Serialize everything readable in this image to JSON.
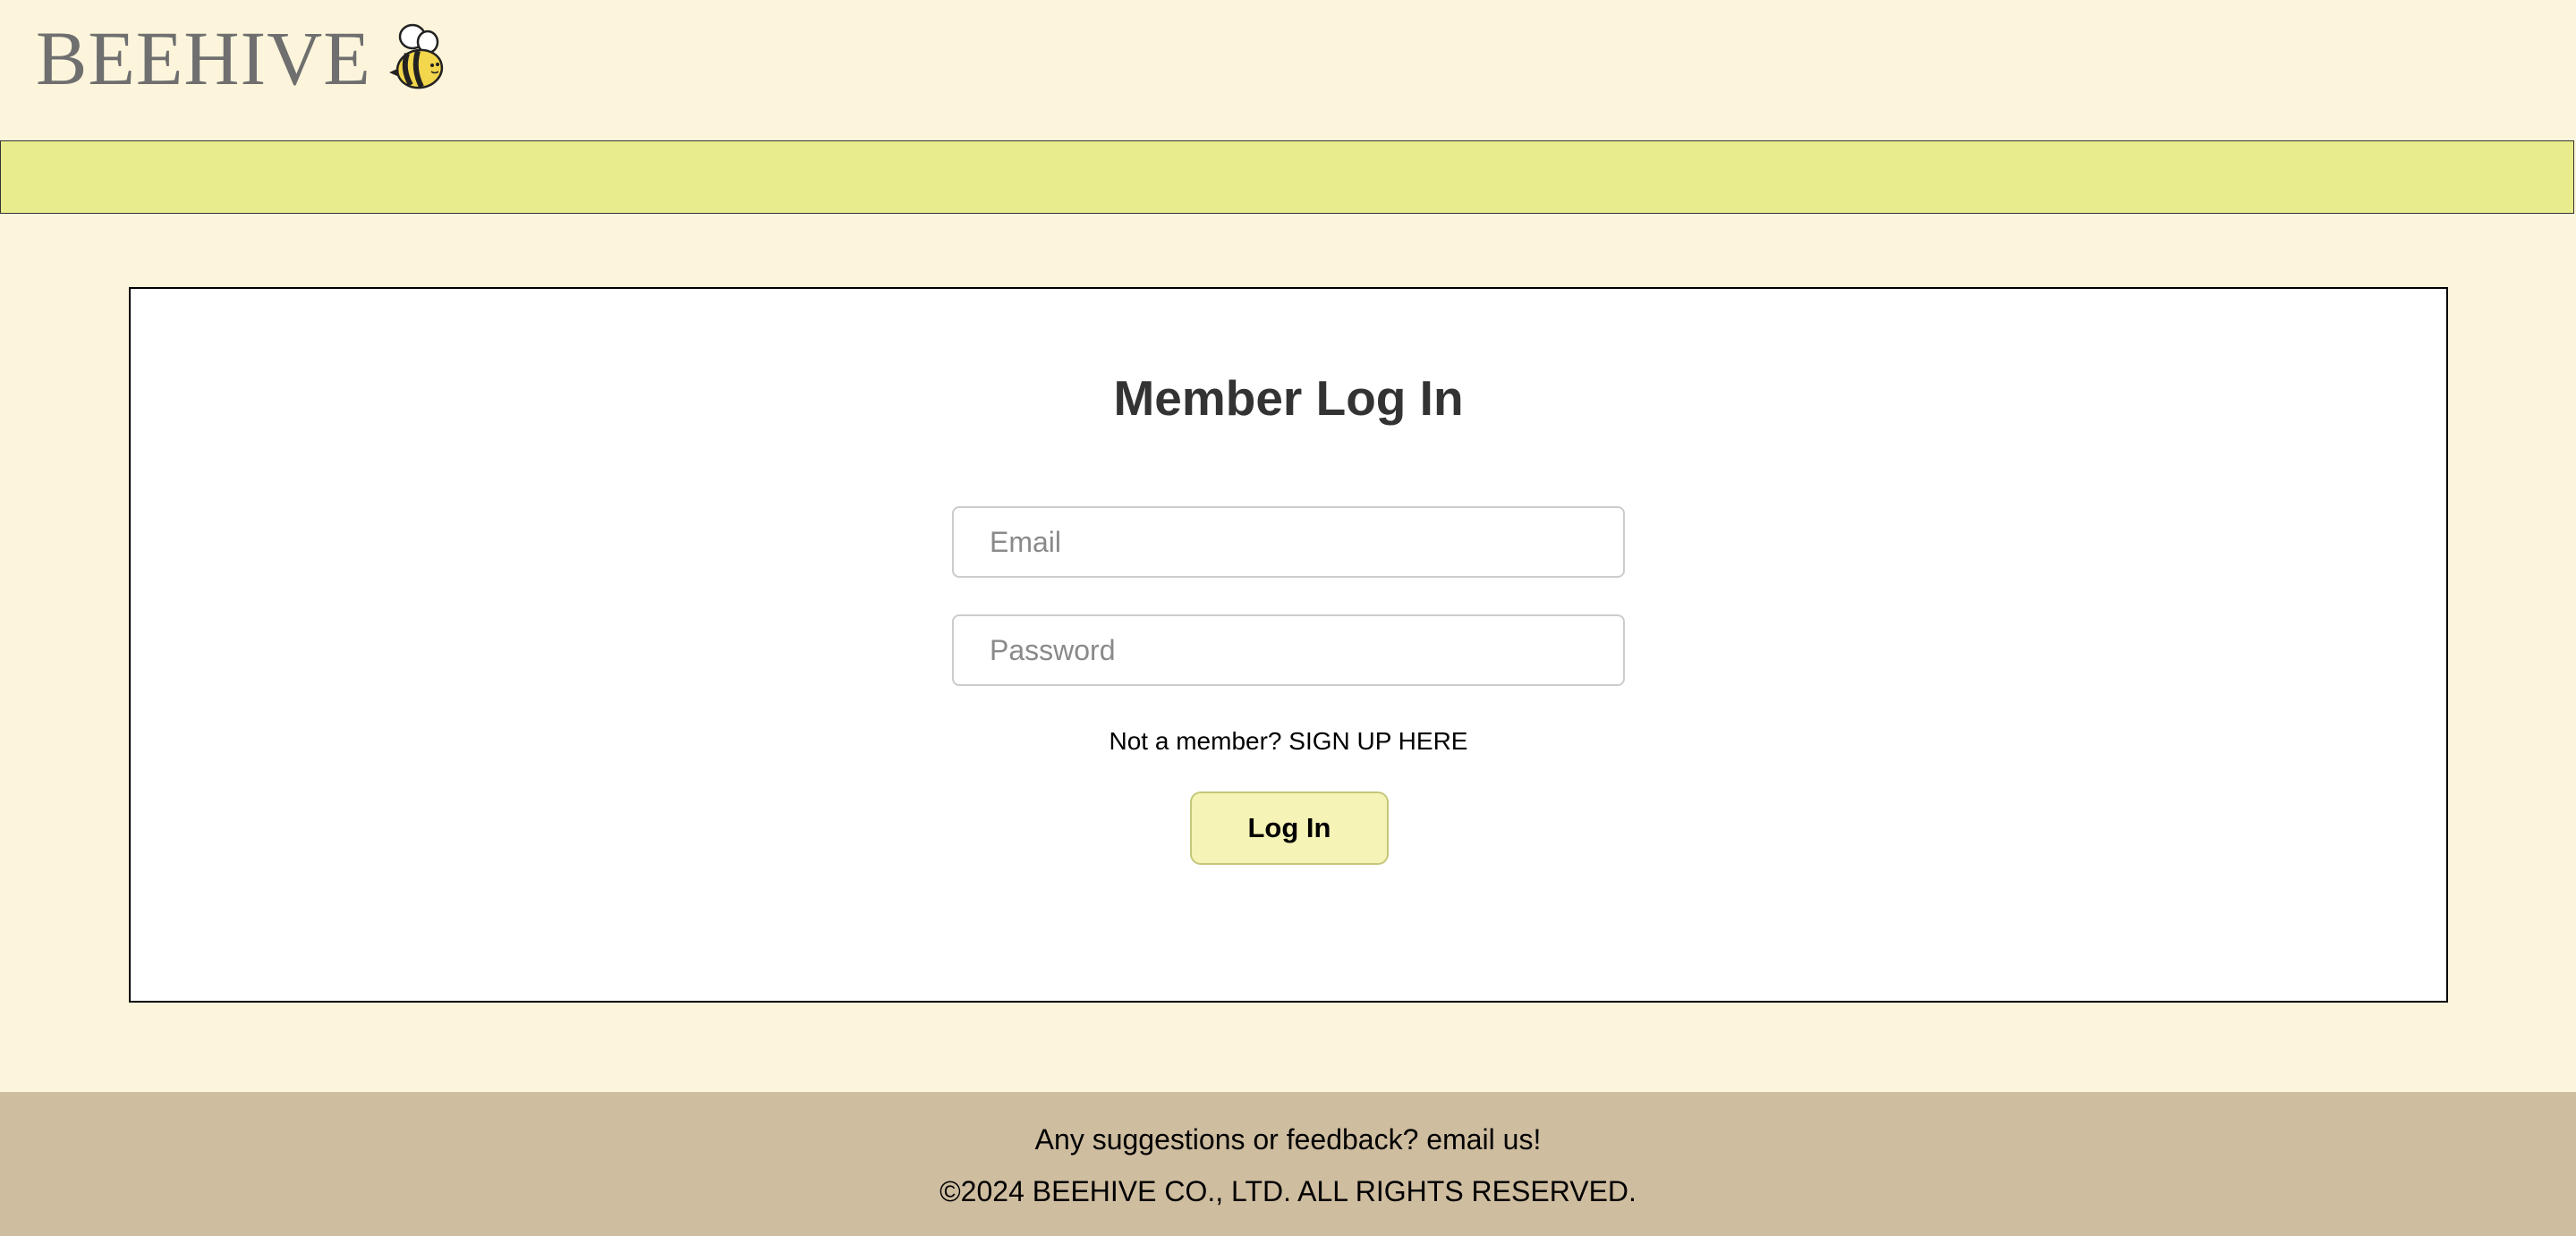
{
  "header": {
    "logo_text": "BEEHIVE",
    "logo_icon": "bee-icon"
  },
  "login": {
    "title": "Member Log In",
    "email_placeholder": "Email",
    "password_placeholder": "Password",
    "signup_prompt": "Not a member?",
    "signup_link": "SIGN UP HERE",
    "submit_label": "Log In"
  },
  "footer": {
    "feedback": "Any suggestions or feedback? email us!",
    "copyright": "©2024 BEEHIVE CO., LTD. ALL RIGHTS RESERVED."
  },
  "colors": {
    "page_background": "#fcf5dc",
    "nav_bar": "#e8ec8c",
    "button_background": "#f5f3b5",
    "footer_background": "#cfbda0"
  }
}
